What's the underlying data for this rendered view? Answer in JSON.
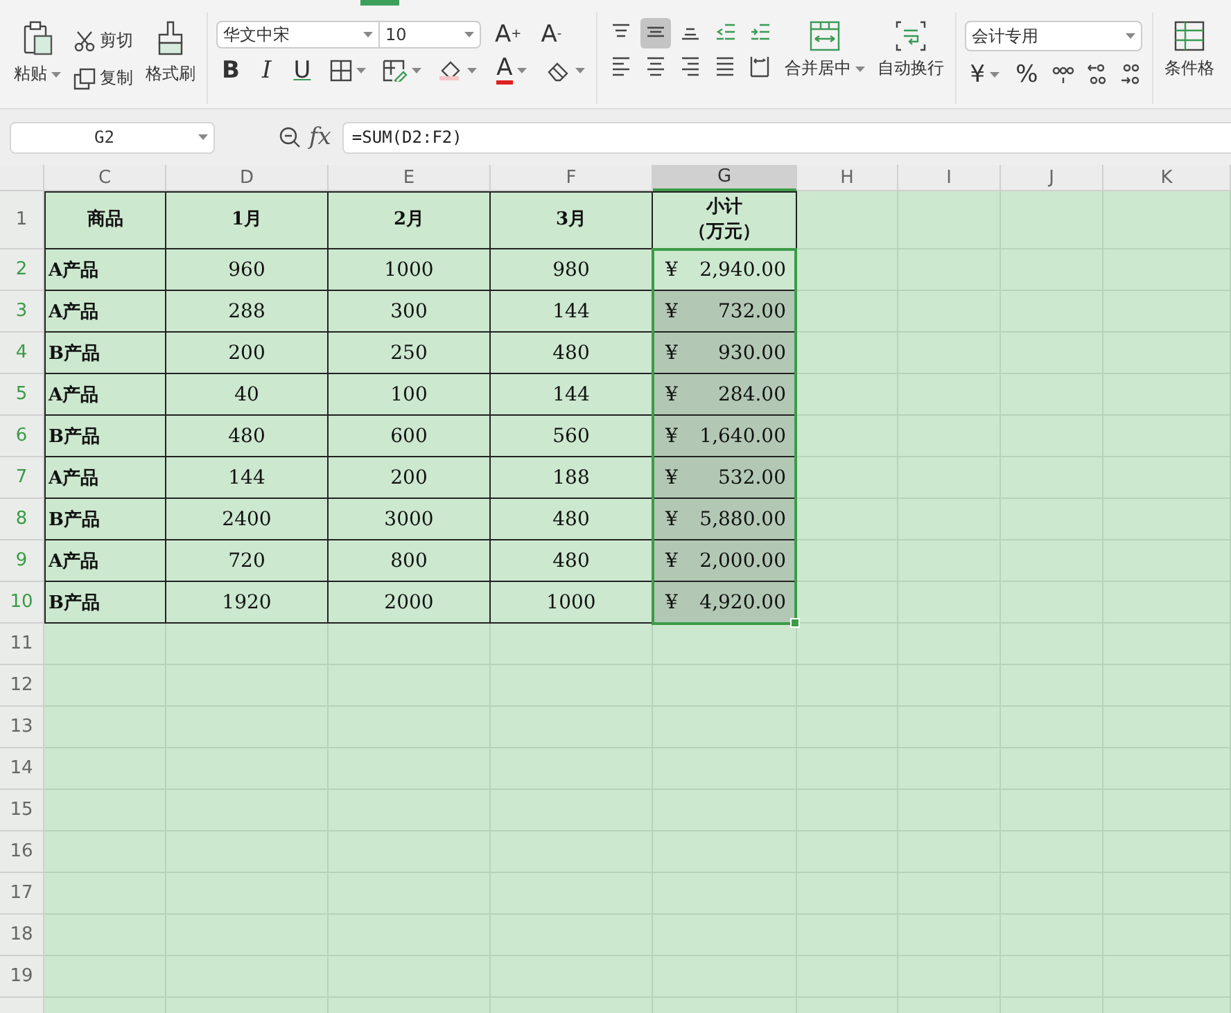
{
  "ribbon": {
    "paste": "粘贴",
    "cut": "剪切",
    "copy": "复制",
    "format_painter": "格式刷",
    "font_name": "华文中宋",
    "font_size": "10",
    "grow_font": "A$^{+}$",
    "shrink_font": "A$^{-}$",
    "bold": "B",
    "italic": "I",
    "underline": "U",
    "font_color": "A",
    "align_buttons": [
      {
        "kind": "top",
        "selected": false
      },
      {
        "kind": "middle",
        "selected": true
      },
      {
        "kind": "bottom",
        "selected": false
      },
      {
        "kind": "indent-decrease",
        "selected": false
      },
      {
        "kind": "indent-increase",
        "selected": false
      },
      {
        "kind": "left",
        "selected": false
      },
      {
        "kind": "center",
        "selected": false
      },
      {
        "kind": "right",
        "selected": false
      },
      {
        "kind": "justify",
        "selected": false
      },
      {
        "kind": "distributed",
        "selected": false
      }
    ],
    "merge_center": "合并居中",
    "wrap_text": "自动换行",
    "number_format": "会计专用",
    "currency": "¥",
    "percent": "%",
    "conditional_format": "条件格"
  },
  "formula_bar": {
    "cell_name": "G2",
    "fx": "fx",
    "formula": "=SUM(D2:F2)"
  },
  "sheet": {
    "columns": [
      {
        "label": "C",
        "selected": false
      },
      {
        "label": "D",
        "selected": false
      },
      {
        "label": "E",
        "selected": false
      },
      {
        "label": "F",
        "selected": false
      },
      {
        "label": "G",
        "selected": true
      },
      {
        "label": "H",
        "selected": false
      },
      {
        "label": "I",
        "selected": false
      },
      {
        "label": "J",
        "selected": false
      },
      {
        "label": "K",
        "selected": false
      }
    ],
    "row_numbers": [
      {
        "label": "1",
        "selected": false
      },
      {
        "label": "2",
        "selected": true
      },
      {
        "label": "3",
        "selected": true
      },
      {
        "label": "4",
        "selected": true
      },
      {
        "label": "5",
        "selected": true
      },
      {
        "label": "6",
        "selected": true
      },
      {
        "label": "7",
        "selected": true
      },
      {
        "label": "8",
        "selected": true
      },
      {
        "label": "9",
        "selected": true
      },
      {
        "label": "10",
        "selected": true
      },
      {
        "label": "11",
        "selected": false
      },
      {
        "label": "12",
        "selected": false
      },
      {
        "label": "13",
        "selected": false
      },
      {
        "label": "14",
        "selected": false
      },
      {
        "label": "15",
        "selected": false
      },
      {
        "label": "16",
        "selected": false
      },
      {
        "label": "17",
        "selected": false
      },
      {
        "label": "18",
        "selected": false
      },
      {
        "label": "19",
        "selected": false
      }
    ],
    "header": [
      [
        "商品"
      ],
      [
        "1月"
      ],
      [
        "2月"
      ],
      [
        "3月"
      ],
      [
        "小计",
        "（万元）"
      ]
    ],
    "rows": [
      {
        "product": "A产品",
        "d": "960",
        "e": "1000",
        "f": "980",
        "total": {
          "symbol": "¥",
          "amount": "2,940.00",
          "selected": true,
          "active": true
        }
      },
      {
        "product": "A产品",
        "d": "288",
        "e": "300",
        "f": "144",
        "total": {
          "symbol": "¥",
          "amount": "732.00",
          "selected": true,
          "active": false
        }
      },
      {
        "product": "B产品",
        "d": "200",
        "e": "250",
        "f": "480",
        "total": {
          "symbol": "¥",
          "amount": "930.00",
          "selected": true,
          "active": false
        }
      },
      {
        "product": "A产品",
        "d": "40",
        "e": "100",
        "f": "144",
        "total": {
          "symbol": "¥",
          "amount": "284.00",
          "selected": true,
          "active": false
        }
      },
      {
        "product": "B产品",
        "d": "480",
        "e": "600",
        "f": "560",
        "total": {
          "symbol": "¥",
          "amount": "1,640.00",
          "selected": true,
          "active": false
        }
      },
      {
        "product": "A产品",
        "d": "144",
        "e": "200",
        "f": "188",
        "total": {
          "symbol": "¥",
          "amount": "532.00",
          "selected": true,
          "active": false
        }
      },
      {
        "product": "B产品",
        "d": "2400",
        "e": "3000",
        "f": "480",
        "total": {
          "symbol": "¥",
          "amount": "5,880.00",
          "selected": true,
          "active": false
        }
      },
      {
        "product": "A产品",
        "d": "720",
        "e": "800",
        "f": "480",
        "total": {
          "symbol": "¥",
          "amount": "2,000.00",
          "selected": true,
          "active": false
        }
      },
      {
        "product": "B产品",
        "d": "1920",
        "e": "2000",
        "f": "1000",
        "total": {
          "symbol": "¥",
          "amount": "4,920.00",
          "selected": true,
          "active": false
        }
      }
    ]
  }
}
